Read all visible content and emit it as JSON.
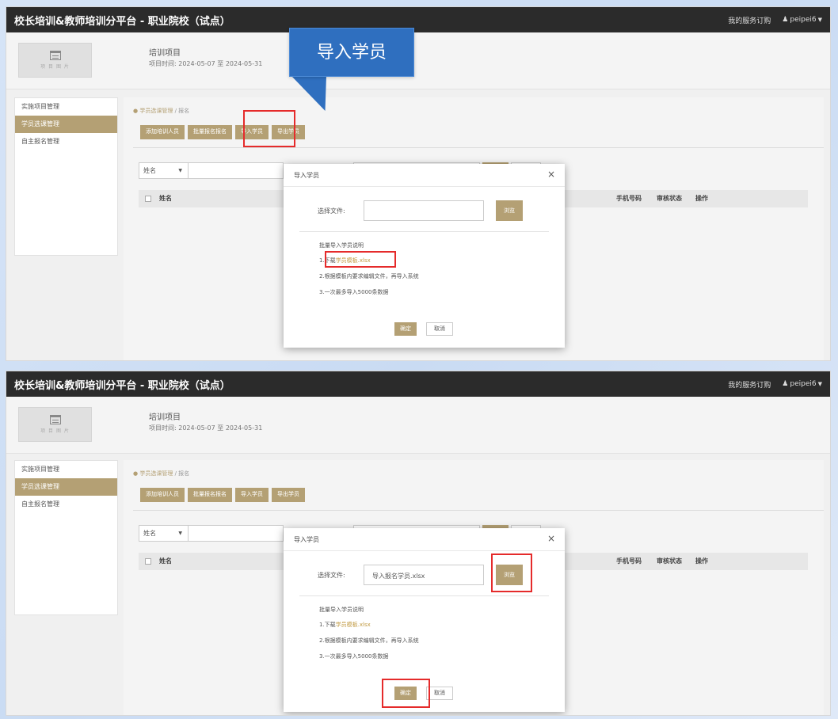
{
  "app": {
    "title": "校长培训&教师培训分平台 - 职业院校（试点）",
    "orders_link": "我的服务订购",
    "user_name": "peipei6"
  },
  "logo": {
    "text": "项 目 图 片"
  },
  "project": {
    "title": "培训项目",
    "time": "项目时间: 2024-05-07 至 2024-05-31"
  },
  "sidebar": {
    "items": [
      {
        "label": "实施项目管理"
      },
      {
        "label": "学员选课管理"
      },
      {
        "label": "自主报名管理"
      }
    ]
  },
  "breadcrumb": {
    "parent": "学员选课管理",
    "separator": " / ",
    "current": "报名"
  },
  "toolbar": {
    "add_label": "添加培训人员",
    "batch_label": "批量报名报名",
    "import_label": "导入学员",
    "export_label": "导出学员"
  },
  "filter": {
    "field": "姓名"
  },
  "table": {
    "columns": {
      "name": "姓名",
      "phone": "手机号码",
      "status": "审核状态",
      "op": "操作"
    }
  },
  "modal": {
    "title": "导入学员",
    "close": "×",
    "file_label": "选择文件:",
    "browse_label": "浏览",
    "instr_title": "批量导入学员说明",
    "instr_1_prefix": "1.下载",
    "instr_1_link": "学员模板.xlsx",
    "instr_2": "2.根据模板内要求编辑文件，再导入系统",
    "instr_3": "3.一次最多导入5000条数据",
    "ok_label": "确定",
    "cancel_label": "取消"
  },
  "screens": {
    "top": {
      "file_value": ""
    },
    "bottom": {
      "file_value": "导入报名学员.xlsx"
    }
  },
  "callout": {
    "text": "导入学员"
  }
}
